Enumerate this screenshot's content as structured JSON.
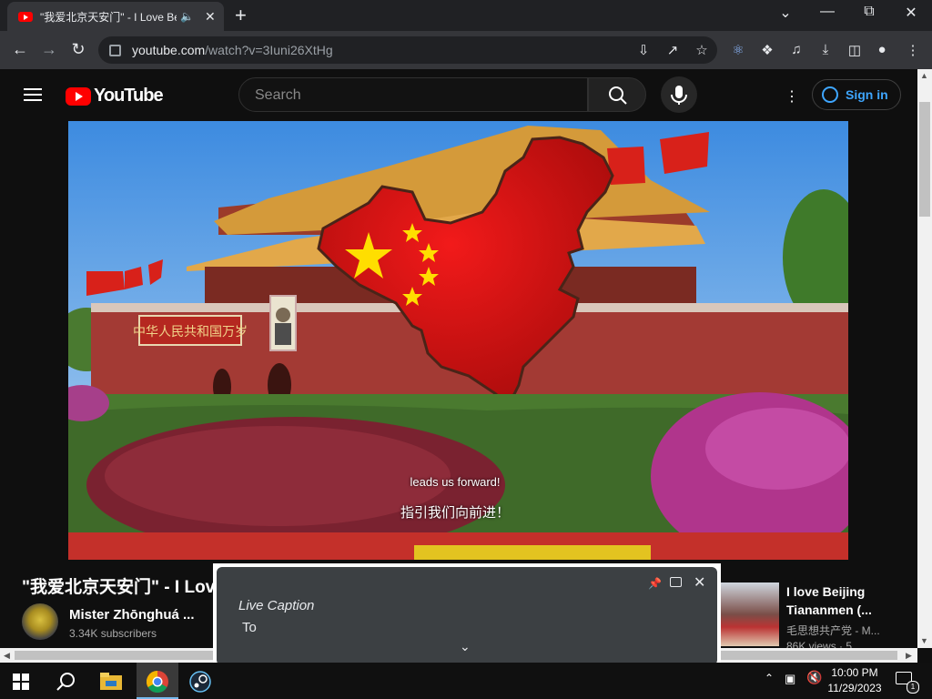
{
  "browser": {
    "tab_title": "\"我爱北京天安门\" - I Love Be",
    "url_host": "youtube.com",
    "url_path": "/watch?v=3Iuni26XtHg"
  },
  "youtube": {
    "logo_text": "YouTube",
    "search_placeholder": "Search",
    "sign_in_label": "Sign in"
  },
  "video": {
    "subtitle_english": "leads us forward!",
    "subtitle_chinese": "指引我们向前进！",
    "banner_text": "中华人民共和国万岁",
    "title": "\"我爱北京天安门\" - I Lov",
    "channel_name": "Mister Zhōnghuá ...",
    "subscribers": "3.34K subscribers"
  },
  "related": {
    "title": "I love Beijing Tiananmen (...",
    "channel": "毛思想共产党 - M...",
    "meta": "86K views · 5"
  },
  "live_caption": {
    "title": "Live Caption",
    "text": "To"
  },
  "taskbar": {
    "time": "10:00 PM",
    "date": "11/29/2023",
    "notification_count": "1"
  },
  "colors": {
    "youtube_red": "#ff0000",
    "sign_in_blue": "#3ea6ff",
    "flag_red": "#de2910",
    "flag_star": "#ffde00"
  }
}
